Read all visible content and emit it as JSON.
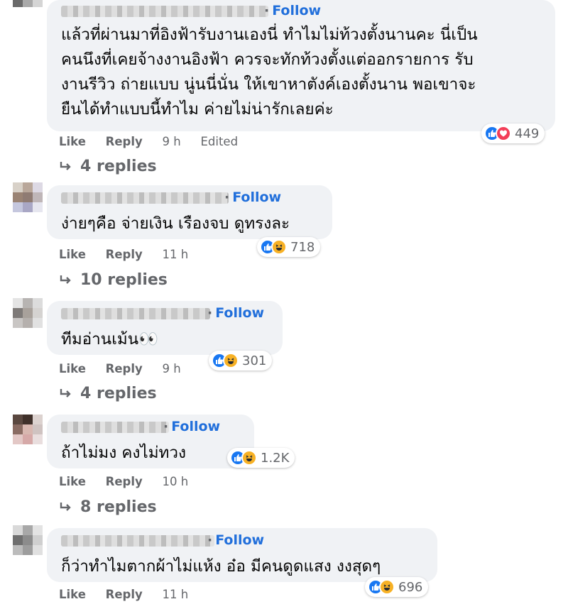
{
  "comments": [
    {
      "follow_label": "Follow",
      "lines": [
        "แล้วที่ผ่านมาที่อิงฟ้ารับงานเองนี่ ทำไมไม่ท้วงตั้งนานคะ นี่เป็น",
        "คนนึงที่เคยจ้างงานอิงฟ้า ควรจะทักท้วงตั้งแต่ออกรายการ รับ",
        "งานรีวิว ถ่ายแบบ นู่นนี่นั่น ให้เขาหาตังค์เองตั้งนาน พอเขาจะ",
        "ยืนได้ทำแบบนี้ทำไม ค่ายไม่น่ารักเลยค่ะ"
      ],
      "reactions": [
        "like",
        "love"
      ],
      "reaction_count": "449",
      "like_label": "Like",
      "reply_label": "Reply",
      "time": "9 h",
      "edited": "Edited",
      "replies_label": "4 replies"
    },
    {
      "follow_label": "Follow",
      "lines": [
        "ง่ายๆคือ จ่ายเงิน เรืองจบ ดูทรงละ"
      ],
      "reactions": [
        "like",
        "haha"
      ],
      "reaction_count": "718",
      "like_label": "Like",
      "reply_label": "Reply",
      "time": "11 h",
      "replies_label": "10 replies"
    },
    {
      "follow_label": "Follow",
      "lines": [
        "ทีมอ่านเม้น👀"
      ],
      "reactions": [
        "like",
        "haha"
      ],
      "reaction_count": "301",
      "like_label": "Like",
      "reply_label": "Reply",
      "time": "9 h",
      "replies_label": "4 replies"
    },
    {
      "follow_label": "Follow",
      "lines": [
        "ถ้าไม่มง คงไม่ทวง"
      ],
      "reactions": [
        "like",
        "haha"
      ],
      "reaction_count": "1.2K",
      "like_label": "Like",
      "reply_label": "Reply",
      "time": "10 h",
      "replies_label": "8 replies"
    },
    {
      "follow_label": "Follow",
      "lines": [
        "ก็ว่าทำไมตากผ้าไม่แห้ง อ๋อ มีคนดูดแสง งงสุดๆ"
      ],
      "reactions": [
        "like",
        "haha"
      ],
      "reaction_count": "696",
      "like_label": "Like",
      "reply_label": "Reply",
      "time": "11 h"
    }
  ],
  "colors": {
    "bubble": "#f0f2f5",
    "follow": "#216fdb",
    "meta": "#65676b",
    "like": "#1877f2",
    "love": "#f33e58",
    "haha": "#f7b125"
  }
}
